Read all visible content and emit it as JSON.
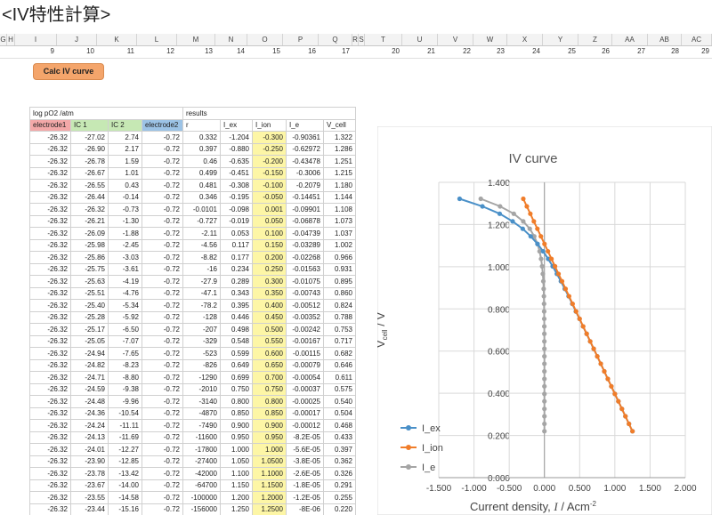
{
  "page_title": "<IV特性計算>",
  "column_headers": [
    "G",
    "H",
    "I",
    "J",
    "K",
    "L",
    "M",
    "N",
    "O",
    "P",
    "Q",
    "R",
    "S",
    "T",
    "U",
    "V",
    "W",
    "X",
    "Y",
    "Z",
    "AA",
    "AB",
    "AC"
  ],
  "index_row": [
    "9",
    "10",
    "11",
    "12",
    "13",
    "14",
    "15",
    "16",
    "17",
    "20",
    "21",
    "22",
    "23",
    "24",
    "25",
    "26",
    "27",
    "28",
    "29"
  ],
  "calc_button_label": "Calc IV curve",
  "table": {
    "row1": [
      "log pO2 /atm",
      "results"
    ],
    "headers": [
      "electrode1",
      "IC 1",
      "IC 2",
      "electrode2",
      "r",
      "I_ex",
      "I_ion",
      "I_e",
      "V_cell"
    ],
    "rows": [
      [
        "-26.32",
        "-27.02",
        "2.74",
        "-0.72",
        "0.332",
        "-1.204",
        "-0.300",
        "-0.90361",
        "1.322"
      ],
      [
        "-26.32",
        "-26.90",
        "2.17",
        "-0.72",
        "0.397",
        "-0.880",
        "-0.250",
        "-0.62972",
        "1.286"
      ],
      [
        "-26.32",
        "-26.78",
        "1.59",
        "-0.72",
        "0.46",
        "-0.635",
        "-0.200",
        "-0.43478",
        "1.251"
      ],
      [
        "-26.32",
        "-26.67",
        "1.01",
        "-0.72",
        "0.499",
        "-0.451",
        "-0.150",
        "-0.3006",
        "1.215"
      ],
      [
        "-26.32",
        "-26.55",
        "0.43",
        "-0.72",
        "0.481",
        "-0.308",
        "-0.100",
        "-0.2079",
        "1.180"
      ],
      [
        "-26.32",
        "-26.44",
        "-0.14",
        "-0.72",
        "0.346",
        "-0.195",
        "-0.050",
        "-0.14451",
        "1.144"
      ],
      [
        "-26.32",
        "-26.32",
        "-0.73",
        "-0.72",
        "-0.0101",
        "-0.098",
        "0.001",
        "-0.09901",
        "1.108"
      ],
      [
        "-26.32",
        "-26.21",
        "-1.30",
        "-0.72",
        "-0.727",
        "-0.019",
        "0.050",
        "-0.06878",
        "1.073"
      ],
      [
        "-26.32",
        "-26.09",
        "-1.88",
        "-0.72",
        "-2.11",
        "0.053",
        "0.100",
        "-0.04739",
        "1.037"
      ],
      [
        "-26.32",
        "-25.98",
        "-2.45",
        "-0.72",
        "-4.56",
        "0.117",
        "0.150",
        "-0.03289",
        "1.002"
      ],
      [
        "-26.32",
        "-25.86",
        "-3.03",
        "-0.72",
        "-8.82",
        "0.177",
        "0.200",
        "-0.02268",
        "0.966"
      ],
      [
        "-26.32",
        "-25.75",
        "-3.61",
        "-0.72",
        "-16",
        "0.234",
        "0.250",
        "-0.01563",
        "0.931"
      ],
      [
        "-26.32",
        "-25.63",
        "-4.19",
        "-0.72",
        "-27.9",
        "0.289",
        "0.300",
        "-0.01075",
        "0.895"
      ],
      [
        "-26.32",
        "-25.51",
        "-4.76",
        "-0.72",
        "-47.1",
        "0.343",
        "0.350",
        "-0.00743",
        "0.860"
      ],
      [
        "-26.32",
        "-25.40",
        "-5.34",
        "-0.72",
        "-78.2",
        "0.395",
        "0.400",
        "-0.00512",
        "0.824"
      ],
      [
        "-26.32",
        "-25.28",
        "-5.92",
        "-0.72",
        "-128",
        "0.446",
        "0.450",
        "-0.00352",
        "0.788"
      ],
      [
        "-26.32",
        "-25.17",
        "-6.50",
        "-0.72",
        "-207",
        "0.498",
        "0.500",
        "-0.00242",
        "0.753"
      ],
      [
        "-26.32",
        "-25.05",
        "-7.07",
        "-0.72",
        "-329",
        "0.548",
        "0.550",
        "-0.00167",
        "0.717"
      ],
      [
        "-26.32",
        "-24.94",
        "-7.65",
        "-0.72",
        "-523",
        "0.599",
        "0.600",
        "-0.00115",
        "0.682"
      ],
      [
        "-26.32",
        "-24.82",
        "-8.23",
        "-0.72",
        "-826",
        "0.649",
        "0.650",
        "-0.00079",
        "0.646"
      ],
      [
        "-26.32",
        "-24.71",
        "-8.80",
        "-0.72",
        "-1290",
        "0.699",
        "0.700",
        "-0.00054",
        "0.611"
      ],
      [
        "-26.32",
        "-24.59",
        "-9.38",
        "-0.72",
        "-2010",
        "0.750",
        "0.750",
        "-0.00037",
        "0.575"
      ],
      [
        "-26.32",
        "-24.48",
        "-9.96",
        "-0.72",
        "-3140",
        "0.800",
        "0.800",
        "-0.00025",
        "0.540"
      ],
      [
        "-26.32",
        "-24.36",
        "-10.54",
        "-0.72",
        "-4870",
        "0.850",
        "0.850",
        "-0.00017",
        "0.504"
      ],
      [
        "-26.32",
        "-24.24",
        "-11.11",
        "-0.72",
        "-7490",
        "0.900",
        "0.900",
        "-0.00012",
        "0.468"
      ],
      [
        "-26.32",
        "-24.13",
        "-11.69",
        "-0.72",
        "-11600",
        "0.950",
        "0.950",
        "-8.2E-05",
        "0.433"
      ],
      [
        "-26.32",
        "-24.01",
        "-12.27",
        "-0.72",
        "-17800",
        "1.000",
        "1.000",
        "-5.6E-05",
        "0.397"
      ],
      [
        "-26.32",
        "-23.90",
        "-12.85",
        "-0.72",
        "-27400",
        "1.050",
        "1.0500",
        "-3.8E-05",
        "0.362"
      ],
      [
        "-26.32",
        "-23.78",
        "-13.42",
        "-0.72",
        "-42000",
        "1.100",
        "1.1000",
        "-2.6E-05",
        "0.326"
      ],
      [
        "-26.32",
        "-23.67",
        "-14.00",
        "-0.72",
        "-64700",
        "1.150",
        "1.1500",
        "-1.8E-05",
        "0.291"
      ],
      [
        "-26.32",
        "-23.55",
        "-14.58",
        "-0.72",
        "-100000",
        "1.200",
        "1.2000",
        "-1.2E-05",
        "0.255"
      ],
      [
        "-26.32",
        "-23.44",
        "-15.16",
        "-0.72",
        "-156000",
        "1.250",
        "1.2500",
        "-8E-06",
        "0.220"
      ]
    ]
  },
  "chart_data": {
    "type": "line",
    "title": "IV curve",
    "xlabel_main": "Current density, ",
    "xlabel_var": "I",
    "xlabel_unit": " / Acm",
    "xlabel_sup": "-2",
    "ylabel_main": "V",
    "ylabel_sub": "cell",
    "ylabel_unit": " / V",
    "xlim": [
      -1.5,
      2.0
    ],
    "ylim": [
      0.0,
      1.4
    ],
    "xticks": [
      "-1.500",
      "-1.000",
      "-0.500",
      "0.000",
      "0.500",
      "1.000",
      "1.500",
      "2.000"
    ],
    "yticks": [
      "0.000",
      "0.200",
      "0.400",
      "0.600",
      "0.800",
      "1.000",
      "1.200",
      "1.400"
    ],
    "legend_position": "bottom-left",
    "series": [
      {
        "name": "I_ex",
        "color": "#4a90c8",
        "x": [
          -1.204,
          -0.88,
          -0.635,
          -0.451,
          -0.308,
          -0.195,
          -0.098,
          -0.019,
          0.053,
          0.117,
          0.177,
          0.234,
          0.289,
          0.343,
          0.395,
          0.446,
          0.498,
          0.548,
          0.599,
          0.649,
          0.699,
          0.75,
          0.8,
          0.85,
          0.9,
          0.95,
          1.0,
          1.05,
          1.1,
          1.15,
          1.2,
          1.25
        ],
        "y": [
          1.322,
          1.286,
          1.251,
          1.215,
          1.18,
          1.144,
          1.108,
          1.073,
          1.037,
          1.002,
          0.966,
          0.931,
          0.895,
          0.86,
          0.824,
          0.788,
          0.753,
          0.717,
          0.682,
          0.646,
          0.611,
          0.575,
          0.54,
          0.504,
          0.468,
          0.433,
          0.397,
          0.362,
          0.326,
          0.291,
          0.255,
          0.22
        ]
      },
      {
        "name": "I_ion",
        "color": "#f07d2a",
        "x": [
          -0.3,
          -0.25,
          -0.2,
          -0.15,
          -0.1,
          -0.05,
          0.001,
          0.05,
          0.1,
          0.15,
          0.2,
          0.25,
          0.3,
          0.35,
          0.4,
          0.45,
          0.5,
          0.55,
          0.6,
          0.65,
          0.7,
          0.75,
          0.8,
          0.85,
          0.9,
          0.95,
          1.0,
          1.05,
          1.1,
          1.15,
          1.2,
          1.25
        ],
        "y": [
          1.322,
          1.286,
          1.251,
          1.215,
          1.18,
          1.144,
          1.108,
          1.073,
          1.037,
          1.002,
          0.966,
          0.931,
          0.895,
          0.86,
          0.824,
          0.788,
          0.753,
          0.717,
          0.682,
          0.646,
          0.611,
          0.575,
          0.54,
          0.504,
          0.468,
          0.433,
          0.397,
          0.362,
          0.326,
          0.291,
          0.255,
          0.22
        ]
      },
      {
        "name": "I_e",
        "color": "#a5a5a5",
        "x": [
          -0.90361,
          -0.62972,
          -0.43478,
          -0.3006,
          -0.2079,
          -0.14451,
          -0.09901,
          -0.06878,
          -0.04739,
          -0.03289,
          -0.02268,
          -0.01563,
          -0.01075,
          -0.00743,
          -0.00512,
          -0.00352,
          -0.00242,
          -0.00167,
          -0.00115,
          -0.00079,
          -0.00054,
          -0.00037,
          -0.00025,
          -0.00017,
          -0.00012,
          -8.2e-05,
          -5.6e-05,
          -3.8e-05,
          -2.6e-05,
          -1.8e-05,
          -1.2e-05,
          -8e-06
        ],
        "y": [
          1.322,
          1.286,
          1.251,
          1.215,
          1.18,
          1.144,
          1.108,
          1.073,
          1.037,
          1.002,
          0.966,
          0.931,
          0.895,
          0.86,
          0.824,
          0.788,
          0.753,
          0.717,
          0.682,
          0.646,
          0.611,
          0.575,
          0.54,
          0.504,
          0.468,
          0.433,
          0.397,
          0.362,
          0.326,
          0.291,
          0.255,
          0.22
        ]
      }
    ]
  }
}
